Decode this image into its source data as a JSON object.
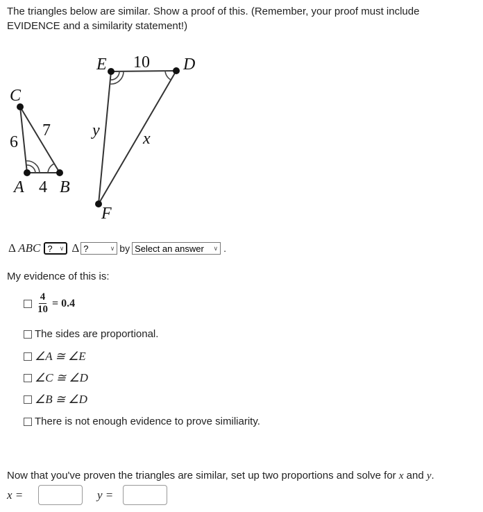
{
  "prompt": "The triangles below are similar. Show a proof of this. (Remember, your proof must include EVIDENCE and a similarity statement!)",
  "figure": {
    "triangle_small": {
      "vertices": {
        "A": "A",
        "B": "B",
        "C": "C"
      },
      "side_AB": "4",
      "side_AC": "6",
      "side_BC": "7"
    },
    "triangle_large": {
      "vertices": {
        "D": "D",
        "E": "E",
        "F": "F"
      },
      "side_ED": "10",
      "side_EF": "y",
      "side_DF": "x"
    },
    "angle_marks": "double arc at A and E; single arc at B and D"
  },
  "statement": {
    "delta": "Δ",
    "first_triangle": "ABC",
    "relation_select": {
      "value": "?"
    },
    "second_delta": "Δ",
    "second_triangle_select": {
      "value": "?"
    },
    "by_label": "by",
    "reason_select": {
      "value": "Select an answer"
    },
    "period": "."
  },
  "evidence": {
    "label": "My evidence of this is:",
    "options": [
      {
        "type": "fraction",
        "numerator": "4",
        "denominator": "10",
        "rest": "= 0.4",
        "checked": false
      },
      {
        "type": "text",
        "text": "The sides are proportional.",
        "checked": false
      },
      {
        "type": "angle",
        "text": "∠A ≅ ∠E",
        "checked": false
      },
      {
        "type": "angle",
        "text": "∠C ≅ ∠D",
        "checked": false
      },
      {
        "type": "angle",
        "text": "∠B ≅ ∠D",
        "checked": false
      },
      {
        "type": "text",
        "text": "There is not enough evidence to prove similiarity.",
        "checked": false
      }
    ]
  },
  "solve": {
    "prompt_prefix": "Now that you've proven the triangles are similar, set up two proportions and solve for ",
    "var_x": "x",
    "and": " and ",
    "var_y": "y",
    "period": ".",
    "x_label": "x =",
    "y_label": "y =",
    "x_value": "",
    "y_value": ""
  }
}
